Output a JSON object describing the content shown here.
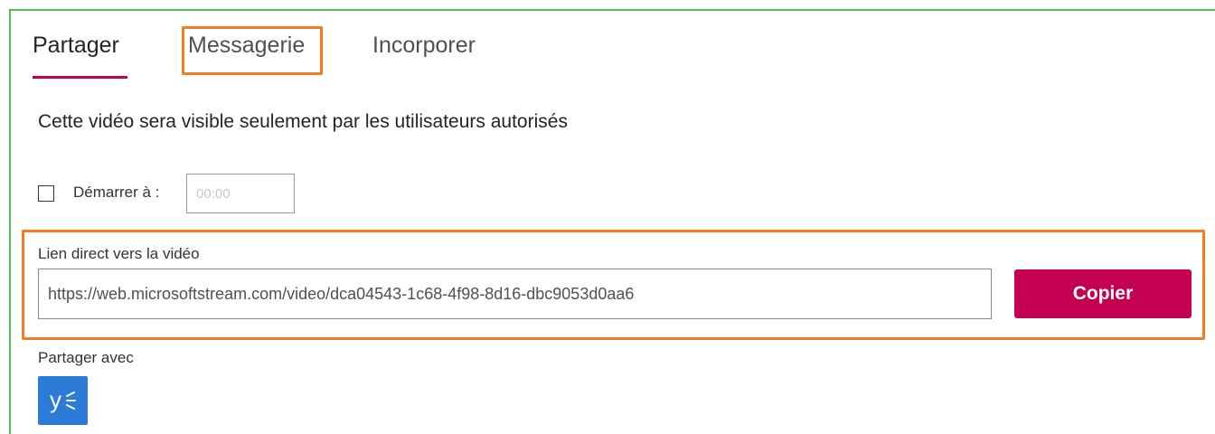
{
  "tabs": [
    {
      "label": "Partager",
      "active": true
    },
    {
      "label": "Messagerie",
      "active": false
    },
    {
      "label": "Incorporer",
      "active": false
    }
  ],
  "notice": "Cette vidéo sera visible seulement par les utilisateurs autorisés",
  "start": {
    "label": "Démarrer à :",
    "checked": false,
    "placeholder": "00:00"
  },
  "link": {
    "label": "Lien direct vers la vidéo",
    "url": "https://web.microsoftstream.com/video/dca04543-1c68-4f98-8d16-dbc9053d0aa6",
    "copy_label": "Copier"
  },
  "share_with": {
    "label": "Partager avec",
    "icons": [
      {
        "name": "yammer-icon",
        "glyph": "y"
      }
    ]
  },
  "colors": {
    "accent": "#c30052",
    "highlight": "#f47c20",
    "frame": "#5cb85c",
    "yammer": "#2c7bd6"
  }
}
